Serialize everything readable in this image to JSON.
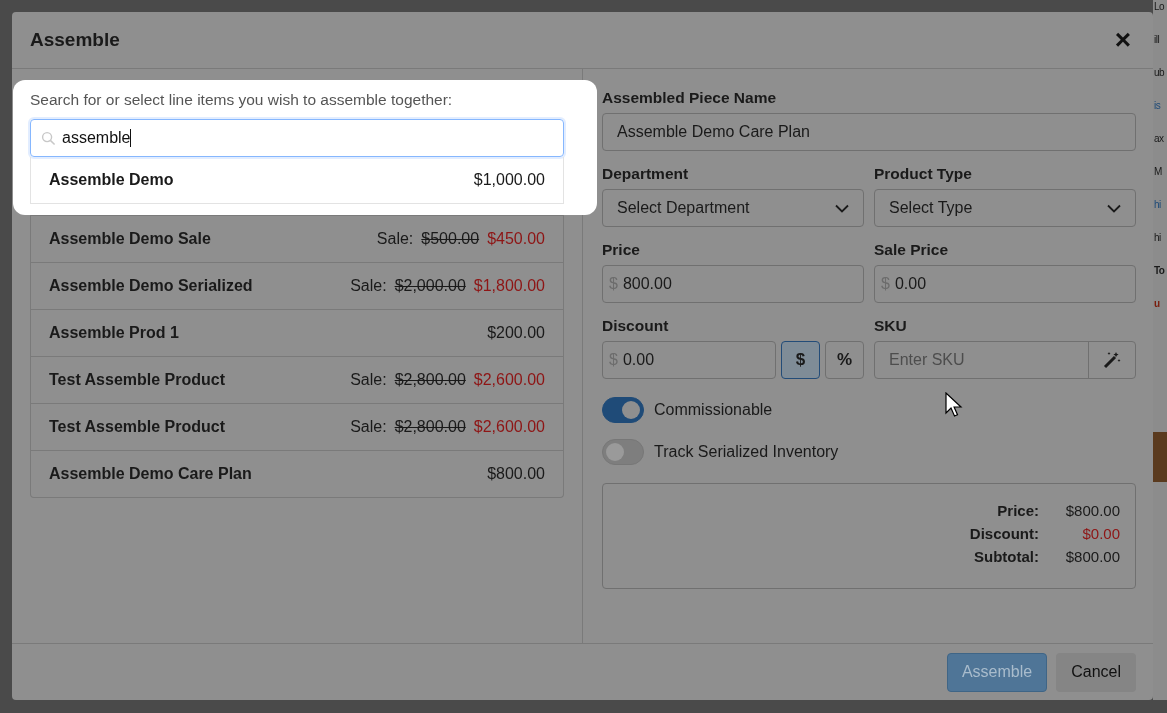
{
  "dialog": {
    "title": "Assemble",
    "close": "×"
  },
  "search": {
    "prompt": "Search for or select line items you wish to assemble together:",
    "value": "assemble"
  },
  "results": [
    {
      "name": "Assemble Demo",
      "kind": "regular",
      "price": "$1,000.00"
    },
    {
      "name": "Assemble Demo Sale",
      "kind": "sale",
      "sale_label": "Sale:",
      "price": "$500.00",
      "sale_price": "$450.00"
    },
    {
      "name": "Assemble Demo Serialized",
      "kind": "sale",
      "sale_label": "Sale:",
      "price": "$2,000.00",
      "sale_price": "$1,800.00"
    },
    {
      "name": "Assemble Prod 1",
      "kind": "regular",
      "price": "$200.00"
    },
    {
      "name": "Test Assemble Product",
      "kind": "sale",
      "sale_label": "Sale:",
      "price": "$2,800.00",
      "sale_price": "$2,600.00"
    },
    {
      "name": "Test Assemble Product",
      "kind": "sale",
      "sale_label": "Sale:",
      "price": "$2,800.00",
      "sale_price": "$2,600.00"
    },
    {
      "name": "Assemble Demo Care Plan",
      "kind": "regular",
      "price": "$800.00"
    }
  ],
  "form": {
    "name": {
      "label": "Assembled Piece Name",
      "value": "Assemble Demo Care Plan"
    },
    "department": {
      "label": "Department",
      "value": "Select Department"
    },
    "product_type": {
      "label": "Product Type",
      "value": "Select Type"
    },
    "price": {
      "label": "Price",
      "prefix": "$",
      "value": "800.00"
    },
    "sale_price": {
      "label": "Sale Price",
      "prefix": "$",
      "value": "0.00"
    },
    "discount": {
      "label": "Discount",
      "prefix": "$",
      "value": "0.00",
      "modes": [
        {
          "symbol": "$",
          "selected": true
        },
        {
          "symbol": "%",
          "selected": false
        }
      ]
    },
    "sku": {
      "label": "SKU",
      "placeholder": "Enter SKU"
    },
    "toggles": [
      {
        "label": "Commissionable",
        "on": true
      },
      {
        "label": "Track Serialized Inventory",
        "on": false
      }
    ]
  },
  "summary": [
    {
      "label": "Price:",
      "value": "$800.00",
      "kind": "normal"
    },
    {
      "label": "Discount:",
      "value": "$0.00",
      "kind": "discount"
    },
    {
      "label": "Subtotal:",
      "value": "$800.00",
      "kind": "normal"
    }
  ],
  "buttons": [
    {
      "label": "Assemble",
      "kind": "primary",
      "disabled": true
    },
    {
      "label": "Cancel",
      "kind": "secondary",
      "disabled": false
    }
  ],
  "background_fragments": [
    {
      "text": "Lo",
      "kind": "plain"
    },
    {
      "text": "ill",
      "kind": "plain"
    },
    {
      "text": "ub",
      "kind": "plain"
    },
    {
      "text": "is",
      "kind": "link"
    },
    {
      "text": "ax",
      "kind": "plain"
    },
    {
      "text": "M",
      "kind": "plain"
    },
    {
      "text": "hi",
      "kind": "link"
    },
    {
      "text": "hi",
      "kind": "plain"
    },
    {
      "text": "To",
      "kind": "bold"
    },
    {
      "text": "u",
      "kind": "alert"
    }
  ]
}
